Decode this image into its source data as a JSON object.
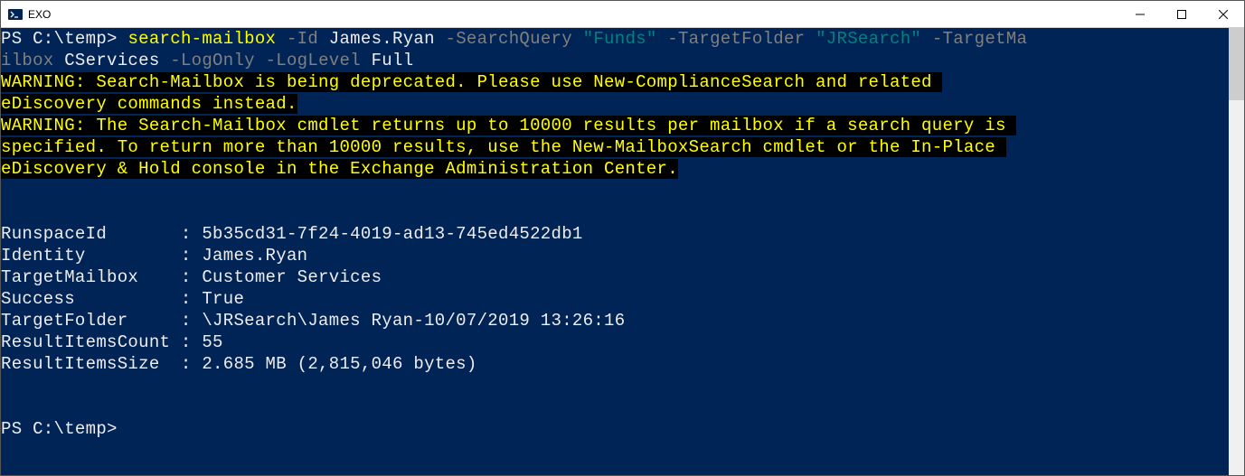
{
  "window": {
    "title": "EXO"
  },
  "command": {
    "prompt1": "PS C:\\temp> ",
    "cmdlet": "search-mailbox",
    "p_id": " -Id ",
    "v_id": "James.Ryan",
    "p_sq": " -SearchQuery ",
    "v_sq": "\"Funds\"",
    "p_tf": " -TargetFolder ",
    "v_tf": "\"JRSearch\"",
    "p_tm_part1": " -TargetMa",
    "p_tm_part2": "ilbox ",
    "v_tm": "CServices",
    "p_lo": " -LogOnly",
    "p_ll": " -LogLevel ",
    "v_ll": "Full"
  },
  "warnings": {
    "w1_l1": "WARNING: Search-Mailbox is being deprecated. Please use New-ComplianceSearch and related ",
    "w1_l2": "eDiscovery commands instead.",
    "w2_l1": "WARNING: The Search-Mailbox cmdlet returns up to 10000 results per mailbox if a search query is ",
    "w2_l2": "specified. To return more than 10000 results, use the New-MailboxSearch cmdlet or the In-Place ",
    "w2_l3": "eDiscovery & Hold console in the Exchange Administration Center."
  },
  "results": {
    "runspaceId": "RunspaceId       : 5b35cd31-7f24-4019-ad13-745ed4522db1",
    "identity": "Identity         : James.Ryan",
    "targetMailbox": "TargetMailbox    : Customer Services",
    "success": "Success          : True",
    "targetFolder": "TargetFolder     : \\JRSearch\\James Ryan-10/07/2019 13:26:16",
    "resultItemsCount": "ResultItemsCount : 55",
    "resultItemsSize": "ResultItemsSize  : 2.685 MB (2,815,046 bytes)"
  },
  "prompt2": "PS C:\\temp>"
}
